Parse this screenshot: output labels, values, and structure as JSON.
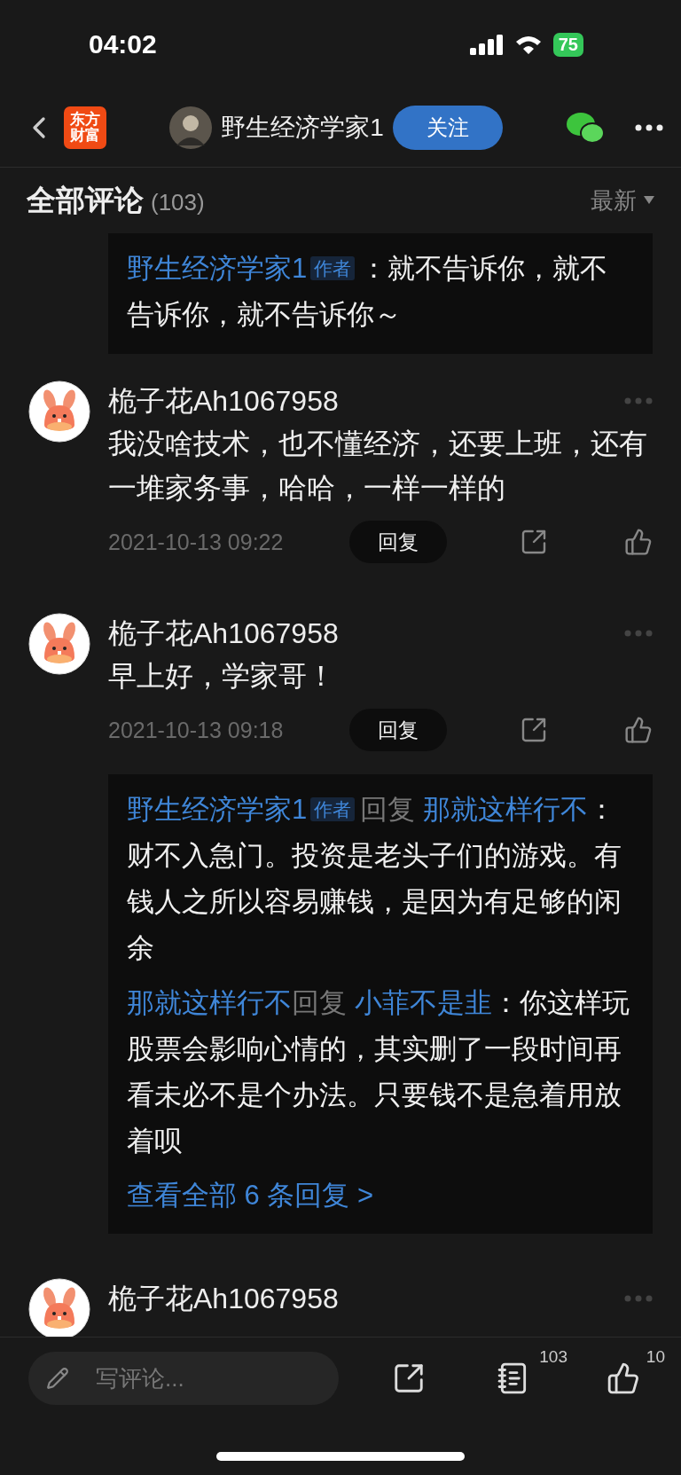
{
  "status_bar": {
    "time": "04:02",
    "battery": "75"
  },
  "header": {
    "logo": [
      "东方",
      "财富"
    ],
    "author": "野生经济学家1",
    "follow_button": "关注"
  },
  "comments_header": {
    "title": "全部评论",
    "count": "(103)",
    "sort": "最新"
  },
  "partial_thread": {
    "replies": [
      {
        "author": "野生经济学家1",
        "badge": "作者",
        "text": "：就不告诉你，就不告诉你，就不告诉你～"
      }
    ]
  },
  "comments": [
    {
      "user": "桅子花Ah1067958",
      "text": "我没啥技术，也不懂经济，还要上班，还有一堆家务事，哈哈，一样一样的",
      "time": "2021-10-13 09:22",
      "reply_button": "回复"
    },
    {
      "user": "桅子花Ah1067958",
      "text": "早上好，学家哥！",
      "time": "2021-10-13 09:18",
      "reply_button": "回复",
      "replies": [
        {
          "author": "野生经济学家1",
          "badge": "作者",
          "reply_word": "回复",
          "target": "那就这样行不",
          "text": "：财不入急门。投资是老头子们的游戏。有钱人之所以容易赚钱，是因为有足够的闲余"
        },
        {
          "author": "那就这样行不",
          "reply_word": "回复",
          "target": "小菲不是韭",
          "text": "：你这样玩股票会影响心情的，其实删了一段时间再看未必不是个办法。只要钱不是急着用放着呗"
        }
      ],
      "more_link": "查看全部 6 条回复 >"
    },
    {
      "user": "桅子花Ah1067958"
    }
  ],
  "bottom_bar": {
    "placeholder": "写评论...",
    "comment_count": "103",
    "like_count": "10"
  }
}
